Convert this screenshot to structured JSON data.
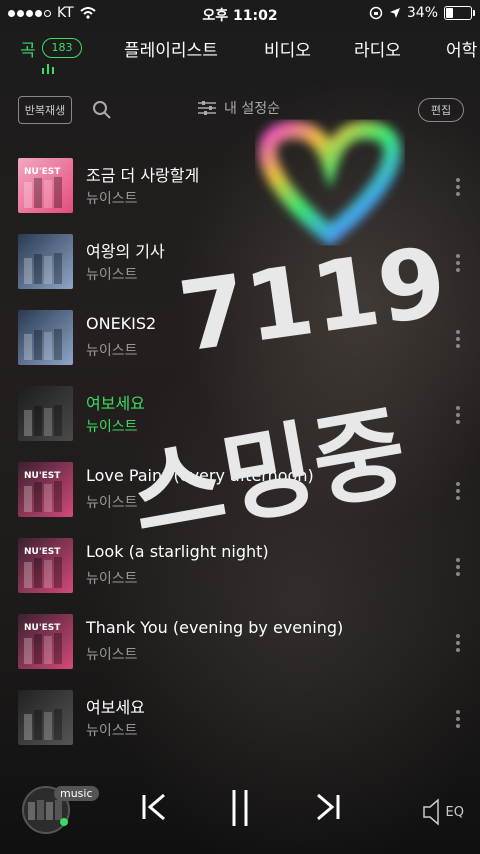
{
  "status": {
    "carrier": "KT",
    "time": "오후 11:02",
    "battery": "34%",
    "battery_level": 0.34
  },
  "tabs": [
    {
      "label": "곡",
      "count": "183"
    },
    {
      "label": "플레이리스트"
    },
    {
      "label": "비디오"
    },
    {
      "label": "라디오"
    },
    {
      "label": "어학"
    }
  ],
  "toolbar": {
    "repeat_label": "반복재생",
    "sort_label": "내 설정순",
    "edit_label": "편집"
  },
  "songs": [
    {
      "title": "조금 더 사랑할게",
      "artist": "뉴이스트"
    },
    {
      "title": "여왕의 기사",
      "artist": "뉴이스트"
    },
    {
      "title": "ONEKIS2",
      "artist": "뉴이스트"
    },
    {
      "title": "여보세요",
      "artist": "뉴이스트"
    },
    {
      "title": "Love Paint (every afternoon)",
      "artist": "뉴이스트"
    },
    {
      "title": "Look (a starlight night)",
      "artist": "뉴이스트"
    },
    {
      "title": "Thank You (evening by evening)",
      "artist": "뉴이스트"
    },
    {
      "title": "여보세요",
      "artist": "뉴이스트"
    }
  ],
  "playing_index": 3,
  "album_art": [
    {
      "text": "NU'EST"
    },
    {
      "text": ""
    },
    {
      "text": ""
    },
    {
      "text": ""
    },
    {
      "text": "NU'EST"
    },
    {
      "text": "NU'EST"
    },
    {
      "text": "NU'EST"
    },
    {
      "text": ""
    }
  ],
  "player": {
    "tag": "music",
    "eq_label": "EQ"
  },
  "sticker": {
    "line1": "7119",
    "line2": "스밍중"
  },
  "colors": {
    "accent": "#3ddc60"
  }
}
